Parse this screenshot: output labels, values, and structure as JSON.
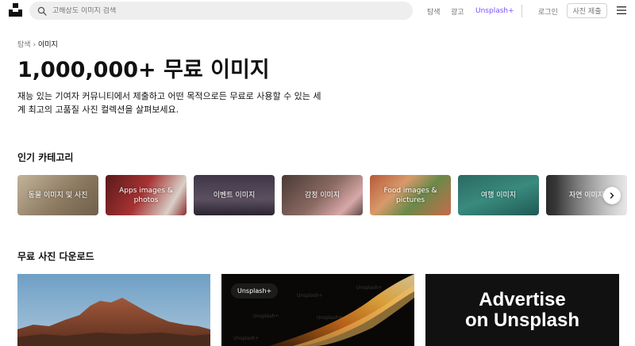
{
  "header": {
    "search_placeholder": "고해상도 이미지 검색",
    "nav_explore": "탐색",
    "nav_ads": "광고",
    "nav_plus": "Unsplash+",
    "nav_login": "로그인",
    "submit_label": "사진 제출",
    "accent_color": "#7c4dff"
  },
  "breadcrumb": {
    "root": "탐색",
    "separator": "›",
    "current": "이미지"
  },
  "hero": {
    "title": "1,000,000+ 무료 이미지",
    "subtitle": "재능 있는 기여자 커뮤니티에서 제출하고 어떤 목적으로든 무료로 사용할 수 있는 세계 최고의 고품질 사진 컬렉션을 살펴보세요."
  },
  "categories": {
    "heading": "인기 카테고리",
    "items": [
      {
        "label": "동물 이미지 및 사진"
      },
      {
        "label": "Apps images & photos"
      },
      {
        "label": "이벤트 이미지"
      },
      {
        "label": "감정 이미지"
      },
      {
        "label": "Food images & pictures"
      },
      {
        "label": "여행 이미지"
      },
      {
        "label": "자연 이미지"
      }
    ]
  },
  "free_photos": {
    "heading": "무료 사진 다운로드",
    "plus_badge": "Unsplash+",
    "watermark": "Unsplash+",
    "ad_line1": "Advertise",
    "ad_line2": "on Unsplash"
  }
}
